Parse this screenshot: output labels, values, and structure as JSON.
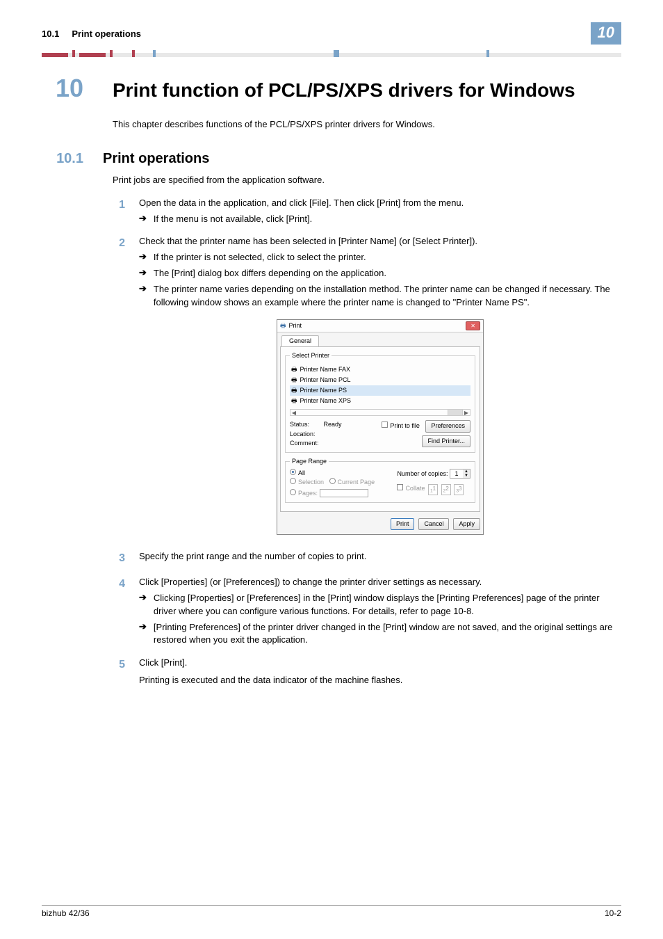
{
  "header": {
    "section_num": "10.1",
    "section_title": "Print operations",
    "badge": "10"
  },
  "chapter": {
    "number": "10",
    "title": "Print function of PCL/PS/XPS drivers for Windows",
    "intro": "This chapter describes functions of the PCL/PS/XPS printer drivers for Windows."
  },
  "section": {
    "number": "10.1",
    "title": "Print operations",
    "intro": "Print jobs are specified from the application software."
  },
  "steps": {
    "s1": {
      "num": "1",
      "text": "Open the data in the application, and click [File]. Then click [Print] from the menu.",
      "sub1": "If the menu is not available, click [Print]."
    },
    "s2": {
      "num": "2",
      "text": "Check that the printer name has been selected in [Printer Name] (or [Select Printer]).",
      "sub1": "If the printer is not selected, click to select the printer.",
      "sub2": "The [Print] dialog box differs depending on the application.",
      "sub3": "The printer name varies depending on the installation method. The printer name can be changed if necessary. The following window shows an example where the printer name is changed to \"Printer Name PS\"."
    },
    "s3": {
      "num": "3",
      "text": "Specify the print range and the number of copies to print."
    },
    "s4": {
      "num": "4",
      "text": "Click [Properties] (or [Preferences]) to change the printer driver settings as necessary.",
      "sub1": "Clicking [Properties] or [Preferences] in the [Print] window displays the [Printing Preferences] page of the printer driver where you can configure various functions. For details, refer to page 10-8.",
      "sub2": "[Printing Preferences] of the printer driver changed in the [Print] window are not saved, and the original settings are restored when you exit the application."
    },
    "s5": {
      "num": "5",
      "text": "Click [Print].",
      "after": "Printing is executed and the data indicator of the machine flashes."
    }
  },
  "dialog": {
    "title": "Print",
    "tab": "General",
    "select_printer_legend": "Select Printer",
    "printers": {
      "p0": "Printer Name FAX",
      "p1": "Printer Name PCL",
      "p2": "Printer Name PS",
      "p3": "Printer Name XPS"
    },
    "status_label": "Status:",
    "status_value": "Ready",
    "location_label": "Location:",
    "comment_label": "Comment:",
    "print_to_file": "Print to file",
    "preferences_btn": "Preferences",
    "find_printer_btn": "Find Printer...",
    "page_range_legend": "Page Range",
    "all_label": "All",
    "selection_label": "Selection",
    "current_page_label": "Current Page",
    "pages_label": "Pages:",
    "copies_label": "Number of copies:",
    "copies_value": "1",
    "collate_label": "Collate",
    "collate_icon_1": "1",
    "collate_icon_2": "2",
    "collate_icon_3": "3",
    "btn_print": "Print",
    "btn_cancel": "Cancel",
    "btn_apply": "Apply"
  },
  "footer": {
    "left": "bizhub 42/36",
    "right": "10-2"
  }
}
